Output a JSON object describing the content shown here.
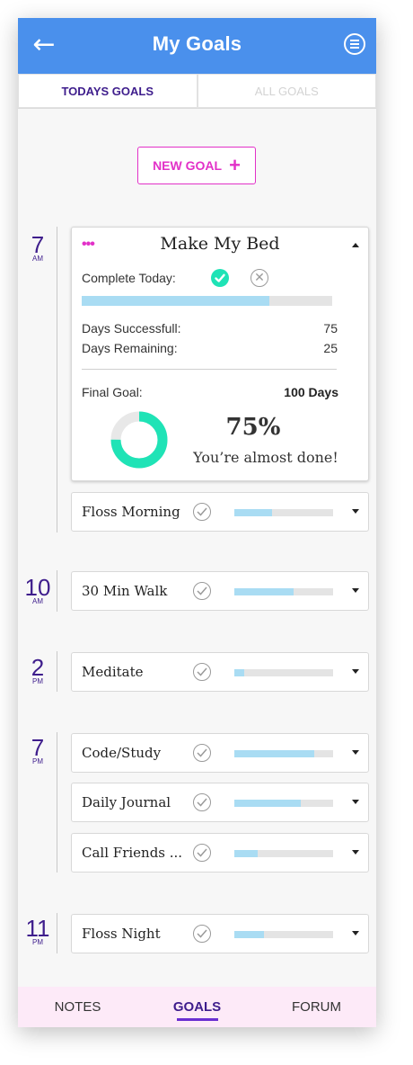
{
  "header": {
    "title": "My Goals",
    "back_icon": "arrow-left-icon",
    "menu_icon": "menu-icon",
    "background": "#4a90ec"
  },
  "tabs": [
    {
      "label": "TODAYS GOALS",
      "active": true
    },
    {
      "label": "ALL GOALS",
      "active": false
    }
  ],
  "new_goal": {
    "label": "NEW GOAL",
    "icon": "plus-icon",
    "accent": "#e231c8"
  },
  "times": [
    {
      "num": "7",
      "ampm": "AM"
    },
    {
      "num": "10",
      "ampm": "AM"
    },
    {
      "num": "2",
      "ampm": "PM"
    },
    {
      "num": "7",
      "ampm": "PM"
    },
    {
      "num": "11",
      "ampm": "PM"
    }
  ],
  "expanded_goal": {
    "title": "Make My Bed",
    "more_icon": "more-dots-icon",
    "complete_today_label": "Complete Today:",
    "progress": 0.75,
    "days_successful_label": "Days Successfull:",
    "days_successful": "75",
    "days_remaining_label": "Days Remaining:",
    "days_remaining": "25",
    "final_goal_label": "Final Goal:",
    "final_goal": "100 Days",
    "percent": "75%",
    "message": "You’re almost done!",
    "done_color": "#1fe3b6"
  },
  "goals": [
    {
      "name": "Floss Morning",
      "progress": 0.38
    },
    {
      "name": "30 Min Walk",
      "progress": 0.6
    },
    {
      "name": "Meditate",
      "progress": 0.1
    },
    {
      "name": "Code/Study",
      "progress": 0.81
    },
    {
      "name": "Daily Journal",
      "progress": 0.67
    },
    {
      "name": "Call Friends ...",
      "progress": 0.24
    },
    {
      "name": "Floss Night",
      "progress": 0.3
    }
  ],
  "bottom_nav": [
    {
      "label": "NOTES",
      "active": false
    },
    {
      "label": "GOALS",
      "active": true
    },
    {
      "label": "FORUM",
      "active": false
    }
  ]
}
